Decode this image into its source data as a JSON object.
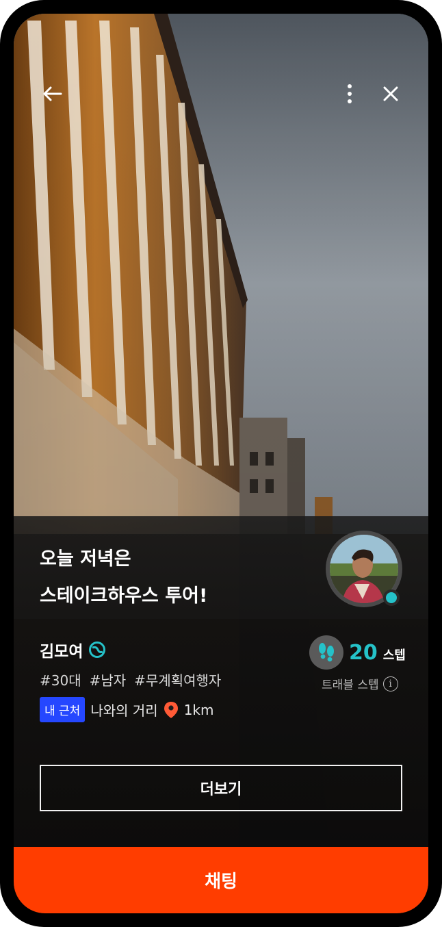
{
  "header": {
    "back_icon": "arrow-left-icon",
    "more_icon": "more-vertical-icon",
    "close_icon": "close-icon"
  },
  "post": {
    "title_line1": "오늘 저녁은",
    "title_line2": "스테이크하우스 투어!"
  },
  "user": {
    "name": "김모여",
    "verified_icon": "globe-badge-icon",
    "online": true,
    "tags": [
      "#30대",
      "#남자",
      "#무계획여행자"
    ],
    "nearby_badge": "내 근처",
    "distance_label": "나와의 거리",
    "distance_value": "1km"
  },
  "travel_steps": {
    "value": "20",
    "unit": "스텝",
    "label": "트래블 스텝",
    "icon": "footprints-icon"
  },
  "actions": {
    "more_label": "더보기",
    "chat_label": "채팅"
  },
  "colors": {
    "accent_teal": "#25c2c9",
    "chat_orange": "#ff3d00",
    "badge_blue": "#2547ff",
    "pin_orange": "#ff5a36"
  }
}
